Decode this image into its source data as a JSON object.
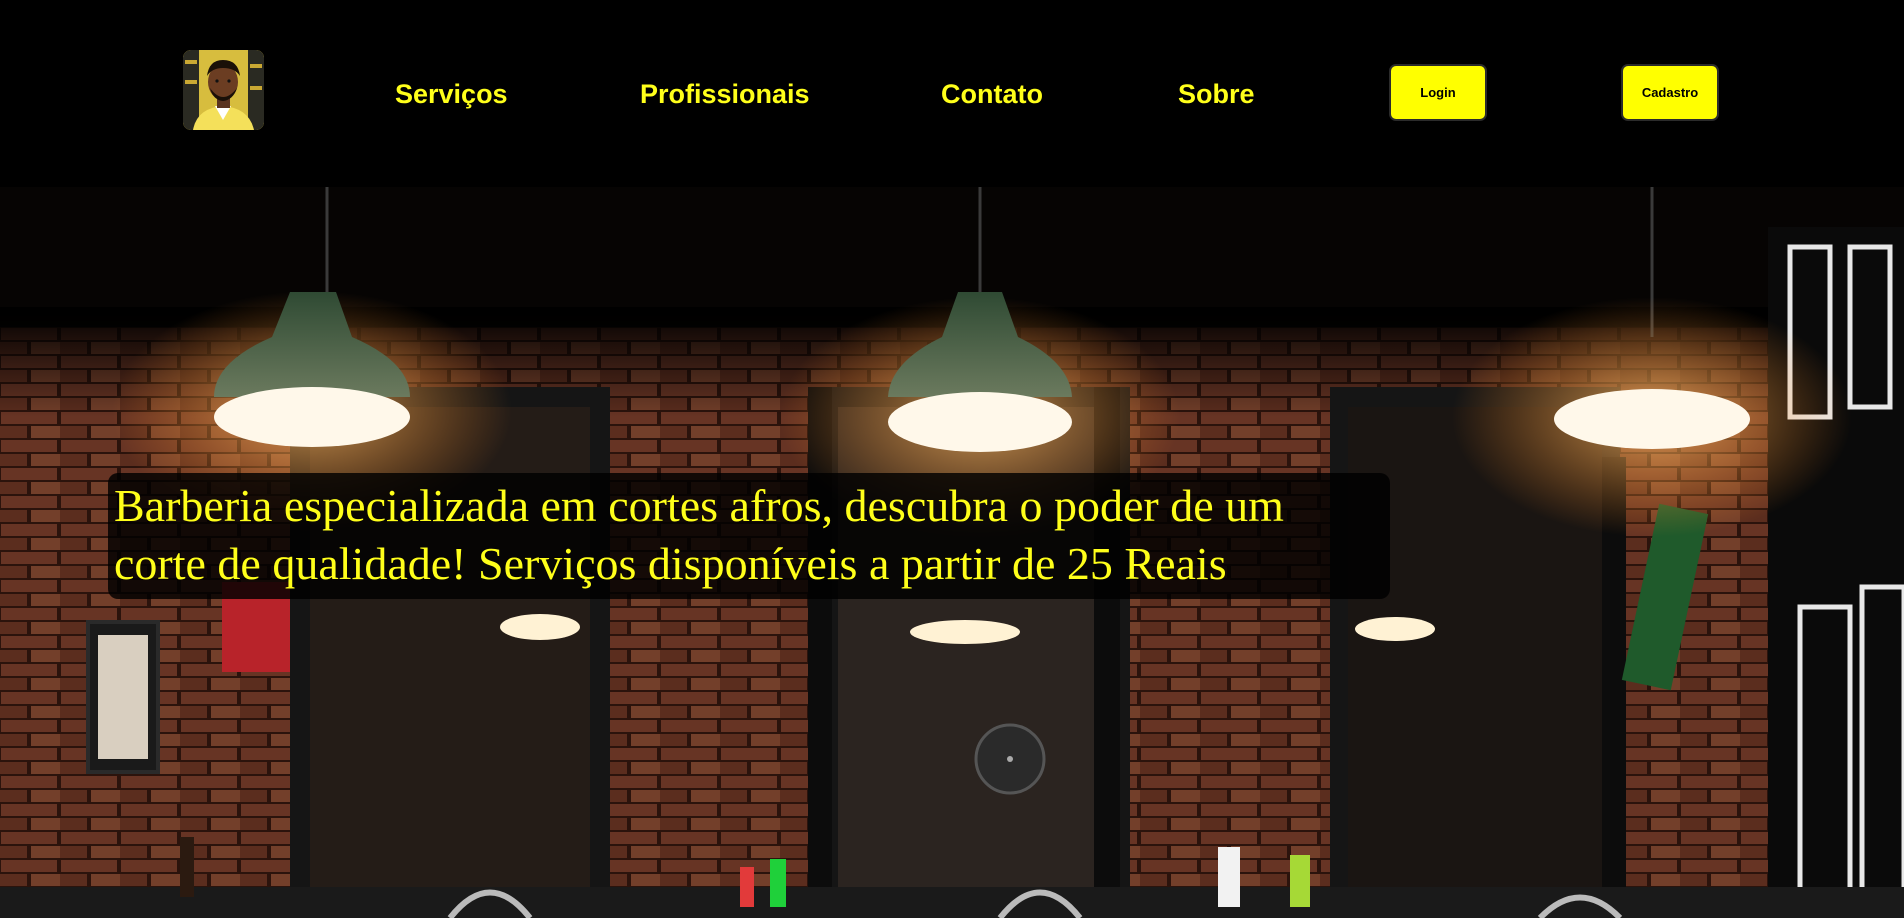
{
  "header": {
    "logo_alt": "Barber avatar logo",
    "nav": [
      {
        "label": "Serviços"
      },
      {
        "label": "Profissionais"
      },
      {
        "label": "Contato"
      },
      {
        "label": "Sobre"
      }
    ],
    "login_label": "Login",
    "signup_label": "Cadastro"
  },
  "hero": {
    "caption": "Barberia especializada em cortes afros, descubra o poder de um corte de qualidade! Serviços disponíveis a partir de 25 Reais",
    "image_subject": "barbershop interior with pendant lamps and brick walls"
  },
  "colors": {
    "accent": "#ffff00",
    "text_accent": "#ffff1a",
    "background": "#000000"
  }
}
